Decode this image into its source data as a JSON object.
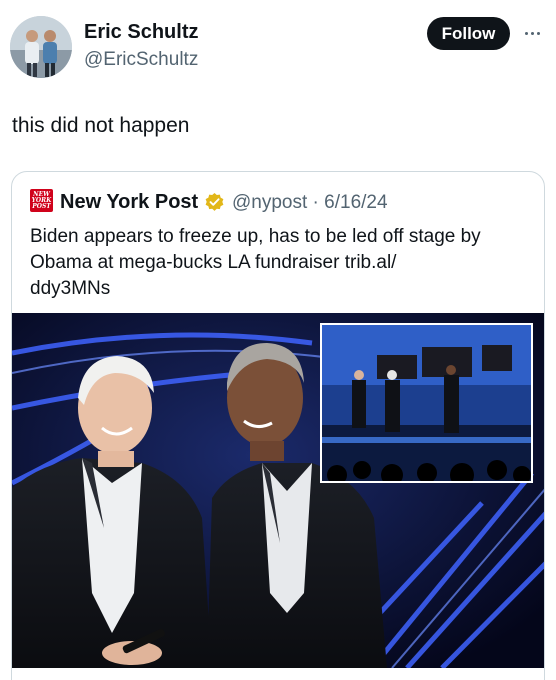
{
  "author": {
    "name": "Eric Schultz",
    "handle": "@EricSchultz"
  },
  "actions": {
    "follow_label": "Follow"
  },
  "tweet": {
    "text": "this did not happen"
  },
  "quoted_tweet": {
    "logo_text": [
      "NEW",
      "YORK",
      "POST"
    ],
    "author_name": "New York Post",
    "handle_and_date": "@nypost · 6/16/24",
    "lines": [
      "Biden appears to freeze up, has to be led off stage by",
      "Obama at mega-bucks LA fundraiser trib.al/",
      "ddy3MNs"
    ]
  },
  "colors": {
    "verified_badge": "#e2b719",
    "nyp_red": "#d0021b",
    "follow_bg": "#0f1419",
    "stage_blue": "#1c3f8f"
  }
}
